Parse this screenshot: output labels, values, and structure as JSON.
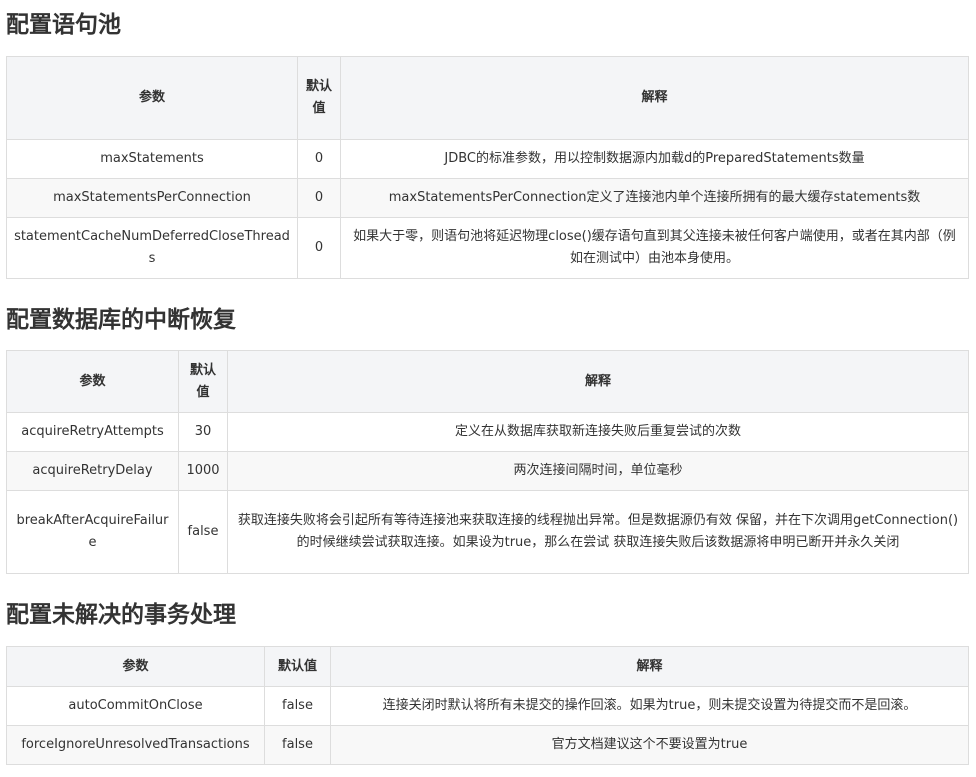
{
  "sections": [
    {
      "title": "配置语句池",
      "headers": [
        "参数",
        "默认值",
        "解释"
      ],
      "rows": [
        {
          "param": "maxStatements",
          "default": "0",
          "desc": "JDBC的标准参数，用以控制数据源内加载d的PreparedStatements数量"
        },
        {
          "param": "maxStatementsPerConnection",
          "default": "0",
          "desc": "maxStatementsPerConnection定义了连接池内单个连接所拥有的最大缓存statements数"
        },
        {
          "param": "statementCacheNumDeferredCloseThreads",
          "default": "0",
          "desc": "如果大于零，则语句池将延迟物理close()缓存语句直到其父连接未被任何客户端使用，或者在其内部（例如在测试中）由池本身使用。"
        }
      ]
    },
    {
      "title": "配置数据库的中断恢复",
      "headers": [
        "参数",
        "默认值",
        "解释"
      ],
      "rows": [
        {
          "param": "acquireRetryAttempts",
          "default": "30",
          "desc": "定义在从数据库获取新连接失败后重复尝试的次数"
        },
        {
          "param": "acquireRetryDelay",
          "default": "1000",
          "desc": "两次连接间隔时间，单位毫秒"
        },
        {
          "param": "breakAfterAcquireFailure",
          "default": "false",
          "desc": "获取连接失败将会引起所有等待连接池来获取连接的线程抛出异常。但是数据源仍有效 保留，并在下次调用getConnection()的时候继续尝试获取连接。如果设为true，那么在尝试 获取连接失败后该数据源将申明已断开并永久关闭"
        }
      ]
    },
    {
      "title": "配置未解决的事务处理",
      "headers": [
        "参数",
        "默认值",
        "解释"
      ],
      "rows": [
        {
          "param": "autoCommitOnClose",
          "default": "false",
          "desc": "连接关闭时默认将所有未提交的操作回滚。如果为true，则未提交设置为待提交而不是回滚。"
        },
        {
          "param": "forceIgnoreUnresolvedTransactions",
          "default": "false",
          "desc": "官方文档建议这个不要设置为true"
        }
      ]
    }
  ]
}
